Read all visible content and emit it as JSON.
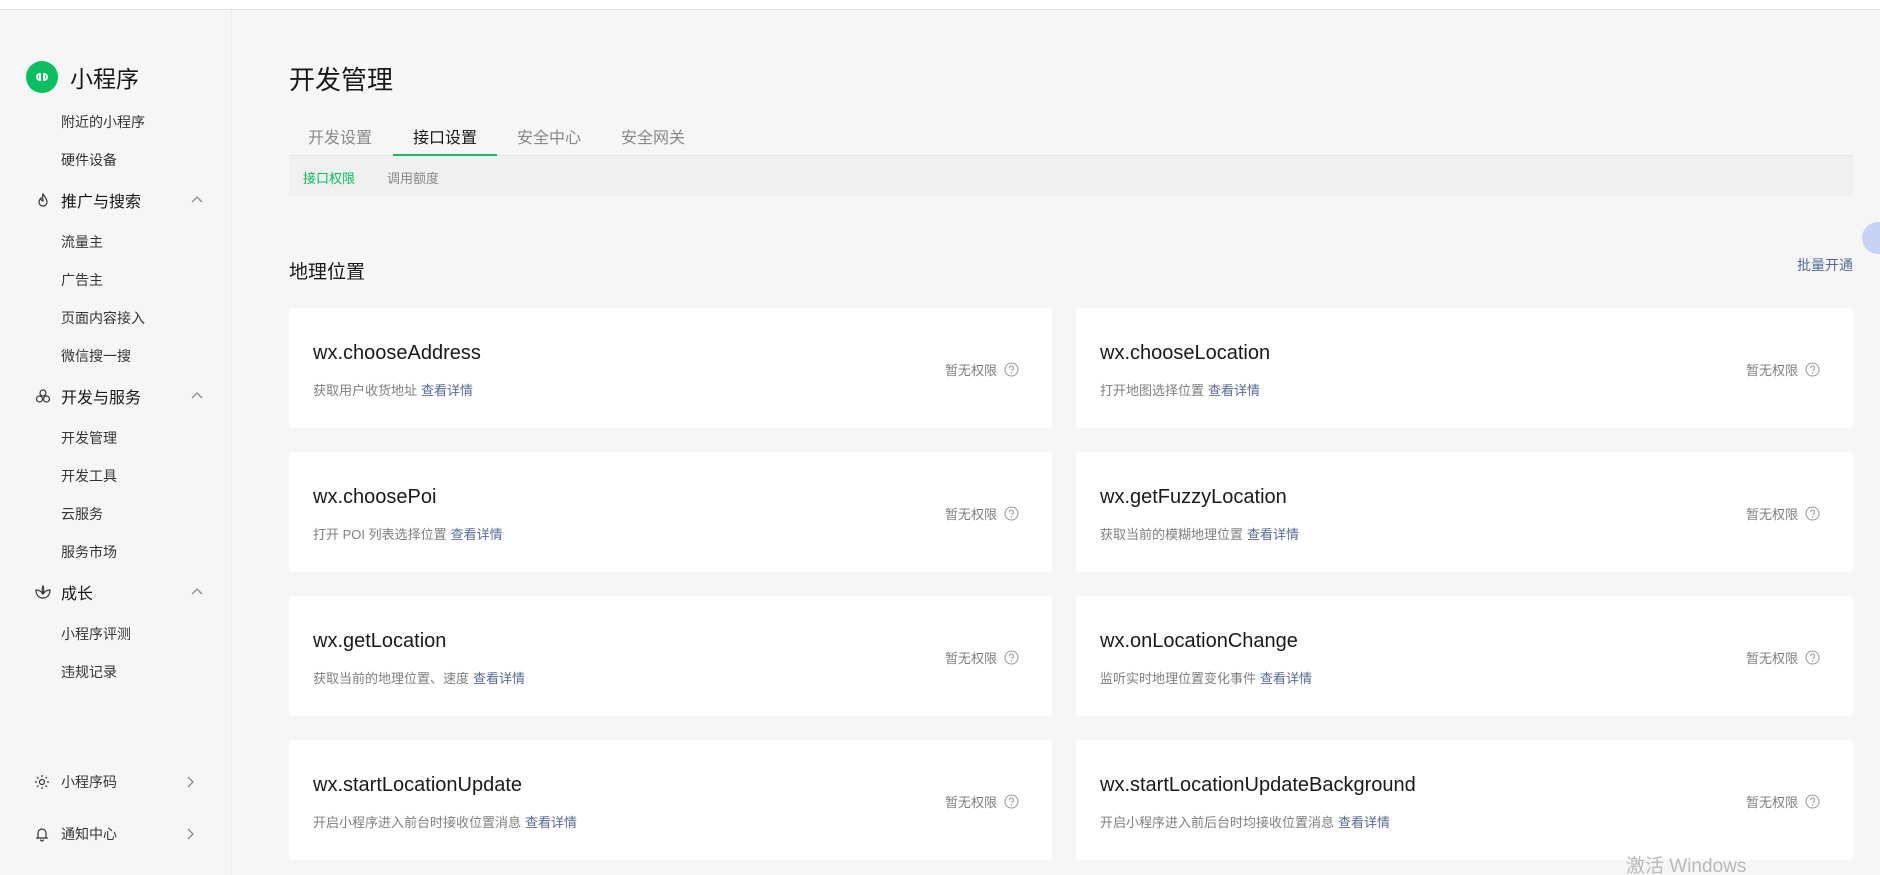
{
  "sidebar": {
    "logo_text": "小程序",
    "items_top": [
      "附近的小程序",
      "硬件设备"
    ],
    "groups": [
      {
        "label": "推广与搜索",
        "icon": "promotion-icon",
        "items": [
          "流量主",
          "广告主",
          "页面内容接入",
          "微信搜一搜"
        ]
      },
      {
        "label": "开发与服务",
        "icon": "dev-service-icon",
        "items": [
          "开发管理",
          "开发工具",
          "云服务",
          "服务市场"
        ]
      },
      {
        "label": "成长",
        "icon": "growth-icon",
        "items": [
          "小程序评测",
          "违规记录"
        ]
      }
    ],
    "bottom": [
      {
        "label": "小程序码",
        "icon": "qrcode-icon"
      },
      {
        "label": "通知中心",
        "icon": "bell-icon"
      }
    ]
  },
  "main": {
    "title": "开发管理",
    "tabs": [
      {
        "label": "开发设置",
        "active": false
      },
      {
        "label": "接口设置",
        "active": true
      },
      {
        "label": "安全中心",
        "active": false
      },
      {
        "label": "安全网关",
        "active": false
      }
    ],
    "subtabs": [
      {
        "label": "接口权限",
        "active": true
      },
      {
        "label": "调用额度",
        "active": false
      }
    ],
    "section_title": "地理位置",
    "batch_link": "批量开通",
    "detail_label": "查看详情",
    "cards": [
      {
        "name": "wx.chooseAddress",
        "desc": "获取用户收货地址",
        "status": "暂无权限"
      },
      {
        "name": "wx.chooseLocation",
        "desc": "打开地图选择位置",
        "status": "暂无权限"
      },
      {
        "name": "wx.choosePoi",
        "desc": "打开 POI 列表选择位置",
        "status": "暂无权限"
      },
      {
        "name": "wx.getFuzzyLocation",
        "desc": "获取当前的模糊地理位置",
        "status": "暂无权限"
      },
      {
        "name": "wx.getLocation",
        "desc": "获取当前的地理位置、速度",
        "status": "暂无权限"
      },
      {
        "name": "wx.onLocationChange",
        "desc": "监听实时地理位置变化事件",
        "status": "暂无权限"
      },
      {
        "name": "wx.startLocationUpdate",
        "desc": "开启小程序进入前台时接收位置消息",
        "status": "暂无权限"
      },
      {
        "name": "wx.startLocationUpdateBackground",
        "desc": "开启小程序进入前后台时均接收位置消息",
        "status": "暂无权限"
      }
    ]
  },
  "watermark": "激活 Windows",
  "colors": {
    "accent": "#07c160",
    "link": "#576b95"
  }
}
